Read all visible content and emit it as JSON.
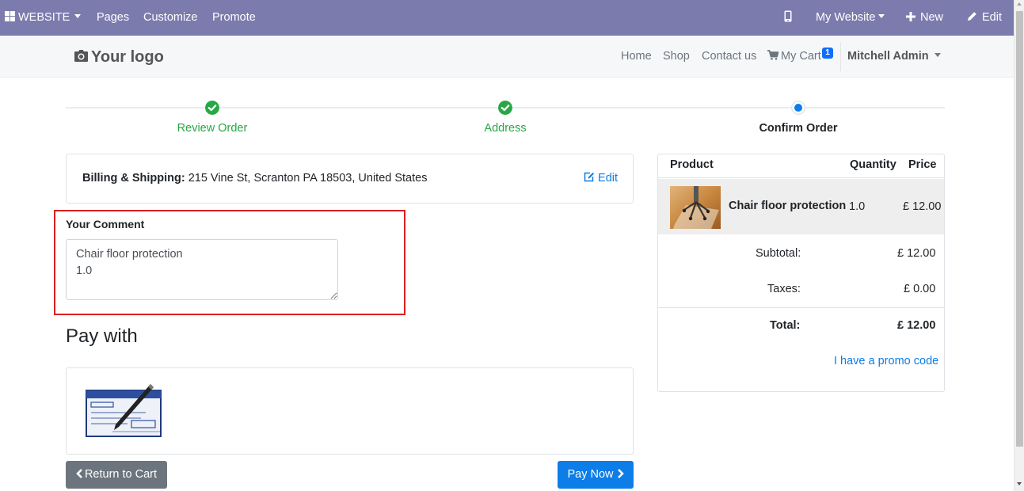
{
  "topbar": {
    "website_label": "WEBSITE",
    "pages_label": "Pages",
    "customize_label": "Customize",
    "promote_label": "Promote",
    "my_website_label": "My Website",
    "new_label": "New",
    "edit_label": "Edit"
  },
  "header": {
    "logo_text": "Your logo",
    "nav": {
      "home": "Home",
      "shop": "Shop",
      "contact": "Contact us",
      "cart": "My Cart",
      "cart_count": "1",
      "user": "Mitchell Admin"
    }
  },
  "steps": [
    {
      "label": "Review Order",
      "status": "done"
    },
    {
      "label": "Address",
      "status": "done"
    },
    {
      "label": "Confirm Order",
      "status": "current"
    }
  ],
  "billing": {
    "label": "Billing & Shipping:",
    "address": "215 Vine St, Scranton PA 18503, United States",
    "edit_label": "Edit"
  },
  "comment": {
    "label": "Your Comment",
    "value": "Chair floor protection\n1.0"
  },
  "payment": {
    "title": "Pay with",
    "method_icon": "check-payment-icon"
  },
  "buttons": {
    "return_label": "Return to Cart",
    "pay_label": "Pay Now"
  },
  "summary": {
    "headers": {
      "product": "Product",
      "quantity": "Quantity",
      "price": "Price"
    },
    "lines": [
      {
        "name": "Chair floor protection",
        "quantity": "1.0",
        "price": "£ 12.00"
      }
    ],
    "subtotal_label": "Subtotal:",
    "subtotal": "£ 12.00",
    "taxes_label": "Taxes:",
    "taxes": "£ 0.00",
    "total_label": "Total:",
    "total": "£ 12.00",
    "promo_label": "I have a promo code"
  },
  "colors": {
    "admin_bar": "#7c7bad",
    "success": "#28a745",
    "primary": "#0d7de8",
    "highlight_border": "#dc1f1f"
  }
}
